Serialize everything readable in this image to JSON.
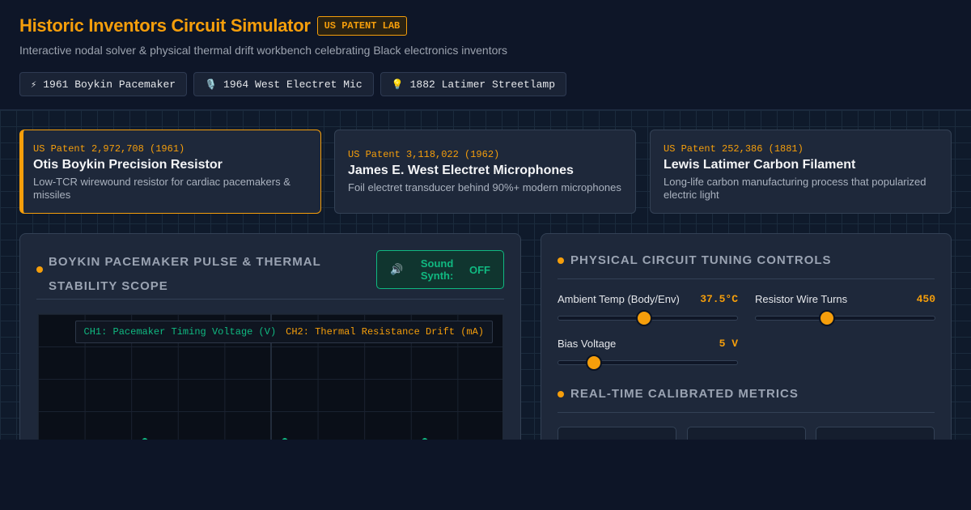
{
  "header": {
    "title": "Historic Inventors Circuit Simulator",
    "badge": "US PATENT LAB",
    "subtitle": "Interactive nodal solver & physical thermal drift workbench celebrating Black electronics inventors"
  },
  "presets": [
    {
      "icon": "⚡",
      "label": "1961 Boykin Pacemaker"
    },
    {
      "icon": "🎙️",
      "label": "1964 West Electret Mic"
    },
    {
      "icon": "💡",
      "label": "1882 Latimer Streetlamp"
    }
  ],
  "inventors": [
    {
      "patent": "US Patent 2,972,708 (1961)",
      "name": "Otis Boykin Precision Resistor",
      "desc": "Low-TCR wirewound resistor for cardiac pacemakers & missiles"
    },
    {
      "patent": "US Patent 3,118,022 (1962)",
      "name": "James E. West Electret Microphones",
      "desc": "Foil electret transducer behind 90%+ modern microphones"
    },
    {
      "patent": "US Patent 252,386 (1881)",
      "name": "Lewis Latimer Carbon Filament",
      "desc": "Long-life carbon manufacturing process that popularized electric light"
    }
  ],
  "scope": {
    "title": "BOYKIN PACEMAKER PULSE & THERMAL STABILITY SCOPE",
    "sound_label": "Sound Synth:",
    "sound_state": "OFF",
    "ch1": "CH1: Pacemaker Timing Voltage (V)",
    "ch2": "CH2: Thermal Resistance Drift (mA)",
    "ch1_color": "#10b981",
    "ch2_color": "#f59e0b"
  },
  "controls": {
    "title": "PHYSICAL CIRCUIT TUNING CONTROLS",
    "items": [
      {
        "label": "Ambient Temp (Body/Env)",
        "value": "37.5°C",
        "level": 0.48
      },
      {
        "label": "Resistor Wire Turns",
        "value": "450",
        "level": 0.4
      },
      {
        "label": "Bias Voltage",
        "value": "5 V",
        "level": 0.2
      }
    ]
  },
  "metrics": {
    "title": "REAL-TIME CALIBRATED METRICS"
  },
  "colors": {
    "accent": "#f59e0b",
    "success": "#10b981",
    "background": "#0d1527"
  }
}
